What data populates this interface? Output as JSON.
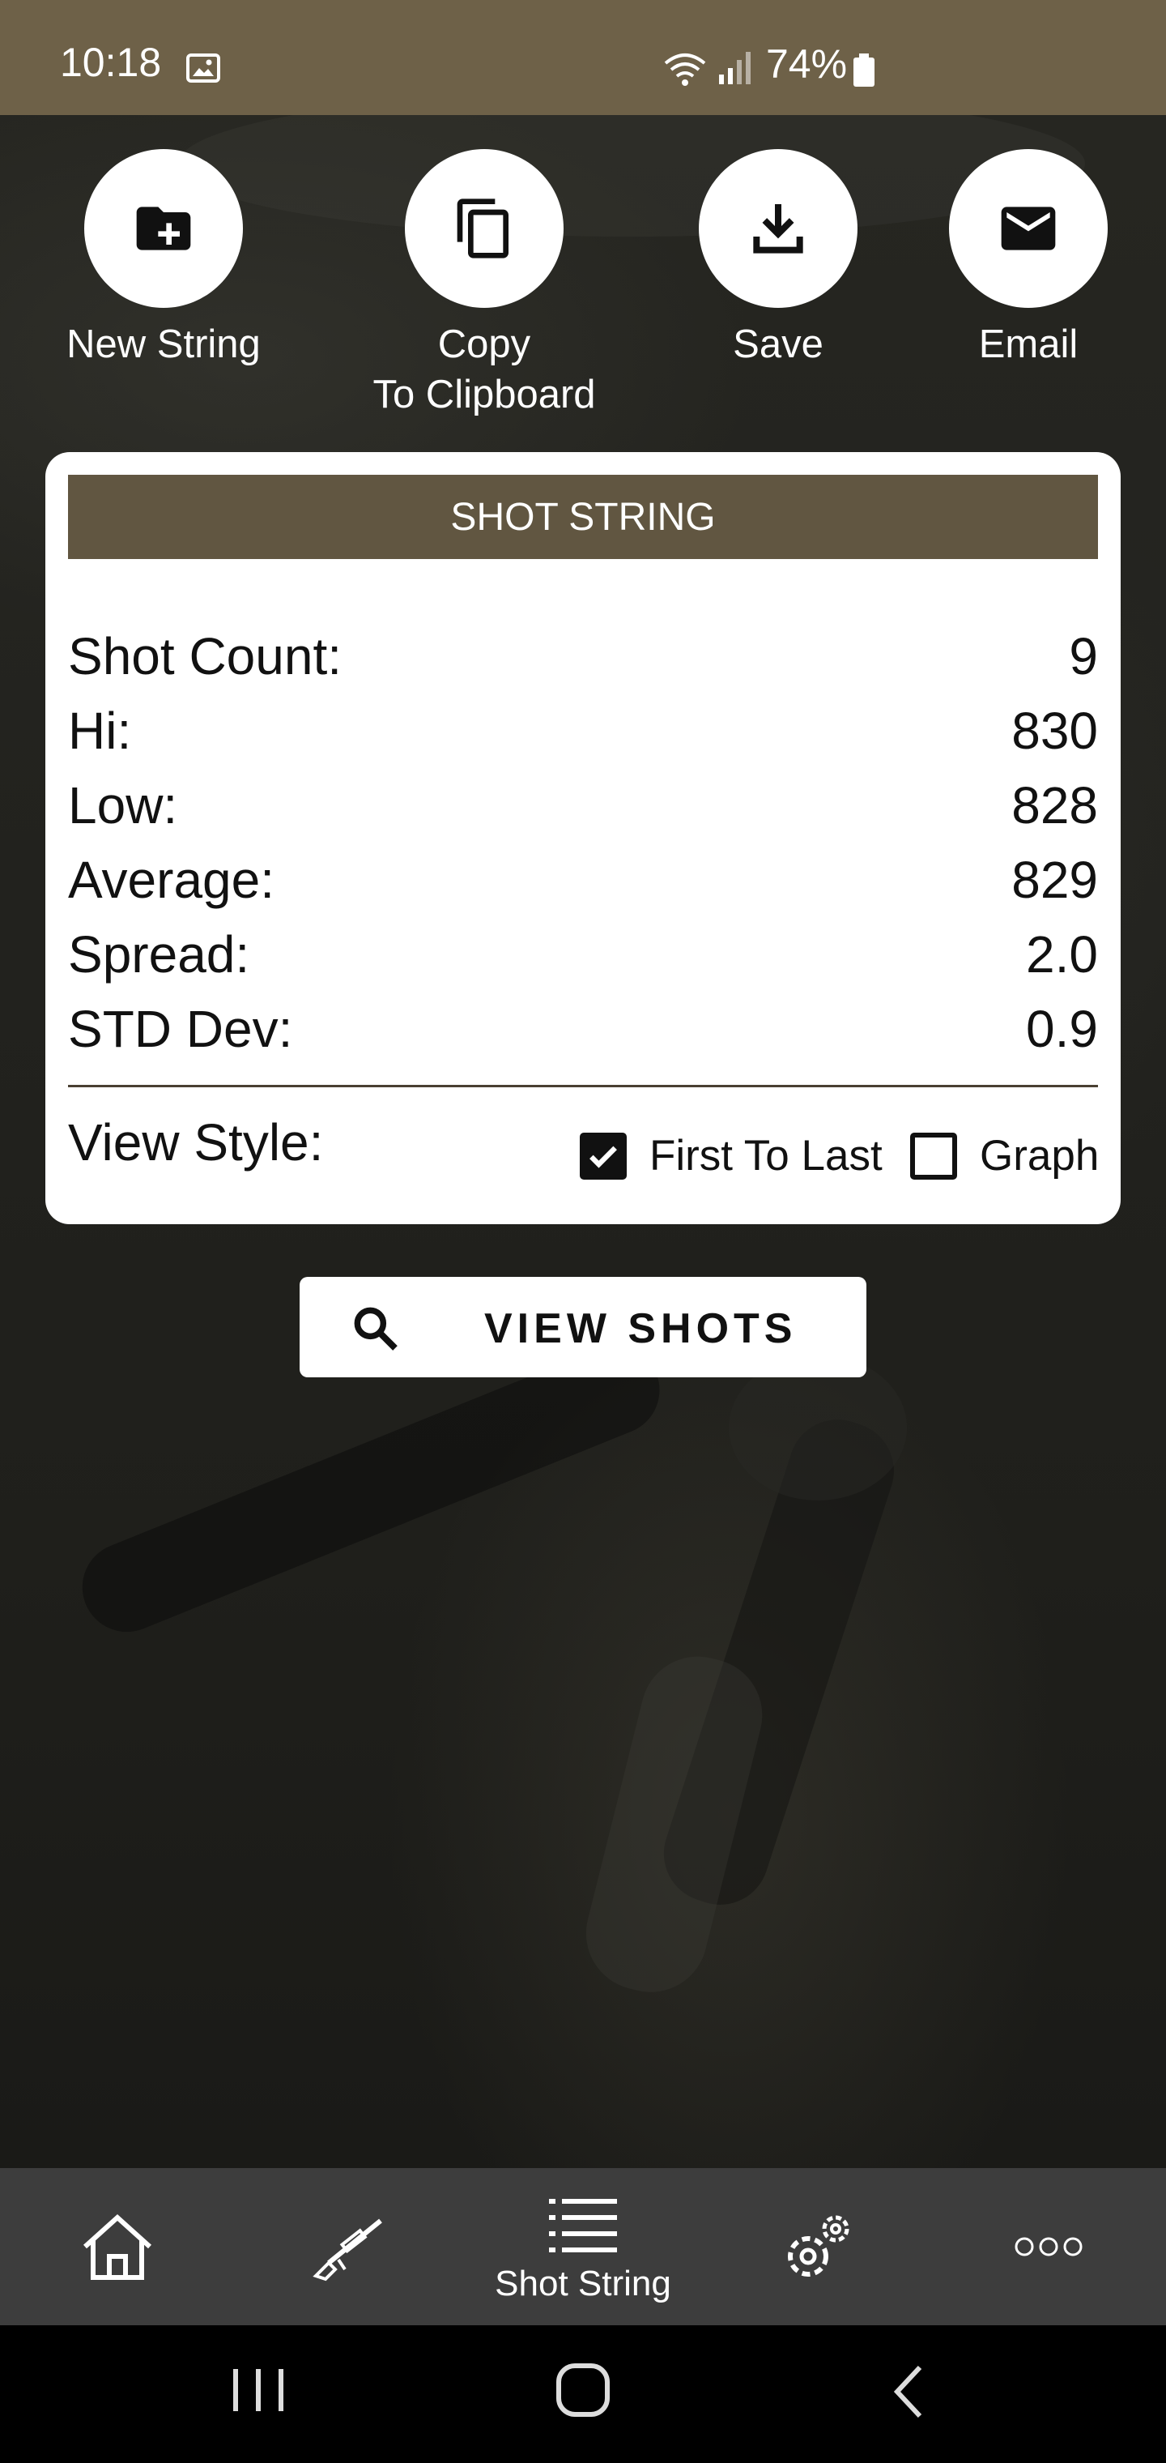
{
  "status_bar": {
    "time": "10:18",
    "battery_percent": "74%",
    "icons": [
      "image-icon",
      "wifi-icon",
      "signal-icon",
      "battery-icon"
    ]
  },
  "actions": [
    {
      "label": "New String",
      "icon": "folder-add-icon"
    },
    {
      "label": "Copy\nTo Clipboard",
      "icon": "copy-icon"
    },
    {
      "label": "Save",
      "icon": "download-icon"
    },
    {
      "label": "Email",
      "icon": "mail-icon"
    }
  ],
  "card": {
    "header": "SHOT STRING",
    "stats": [
      {
        "label": "Shot Count:",
        "value": "9"
      },
      {
        "label": "Hi:",
        "value": "830"
      },
      {
        "label": "Low:",
        "value": "828"
      },
      {
        "label": "Average:",
        "value": "829"
      },
      {
        "label": "Spread:",
        "value": "2.0"
      },
      {
        "label": "STD Dev:",
        "value": "0.9"
      }
    ],
    "view_style": {
      "label": "View Style:",
      "options": [
        {
          "label": "First To Last",
          "checked": true
        },
        {
          "label": "Graph",
          "checked": false
        }
      ]
    }
  },
  "view_shots_button": {
    "label": "VIEW SHOTS",
    "icon": "search-icon"
  },
  "bottom_nav": {
    "items": [
      {
        "icon": "home-icon",
        "label": ""
      },
      {
        "icon": "rifle-icon",
        "label": ""
      },
      {
        "icon": "list-icon",
        "label": "Shot String",
        "active": true
      },
      {
        "icon": "settings-icon",
        "label": ""
      },
      {
        "icon": "more-icon",
        "label": ""
      }
    ]
  },
  "system_nav": [
    "recents-button",
    "home-button",
    "back-button"
  ],
  "colors": {
    "status_bar": "#6e6148",
    "header": "#615641",
    "bottom_nav": "#3d3d3d"
  }
}
